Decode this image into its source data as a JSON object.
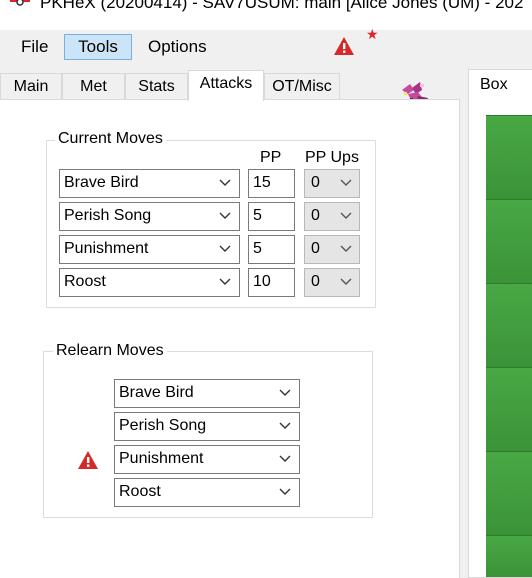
{
  "window": {
    "title": "PKHeX (20200414) - SAV7USUM: main [Alice Jones (UM) - 202"
  },
  "menu": {
    "file": "File",
    "tools": "Tools",
    "options": "Options"
  },
  "tabs": {
    "main": "Main",
    "met": "Met",
    "stats": "Stats",
    "attacks": "Attacks",
    "ot_misc": "OT/Misc"
  },
  "current_moves": {
    "legend": "Current Moves",
    "pp_header": "PP",
    "ppups_header": "PP Ups",
    "rows": [
      {
        "move": "Brave Bird",
        "pp": "15",
        "ppups": "0"
      },
      {
        "move": "Perish Song",
        "pp": "5",
        "ppups": "0"
      },
      {
        "move": "Punishment",
        "pp": "5",
        "ppups": "0"
      },
      {
        "move": "Roost",
        "pp": "10",
        "ppups": "0"
      }
    ]
  },
  "relearn_moves": {
    "legend": "Relearn Moves",
    "rows": [
      "Brave Bird",
      "Perish Song",
      "Punishment",
      "Roost"
    ]
  },
  "box": {
    "tab_label": "Box"
  },
  "colors": {
    "warning": "#d42a2a",
    "box_green": "#3e9a3a",
    "menu_active": "#cce4f7"
  },
  "icons": [
    "app-icon",
    "warning-icon",
    "star-icon",
    "pokemon-sprite-icon",
    "chevron-down-icon"
  ]
}
